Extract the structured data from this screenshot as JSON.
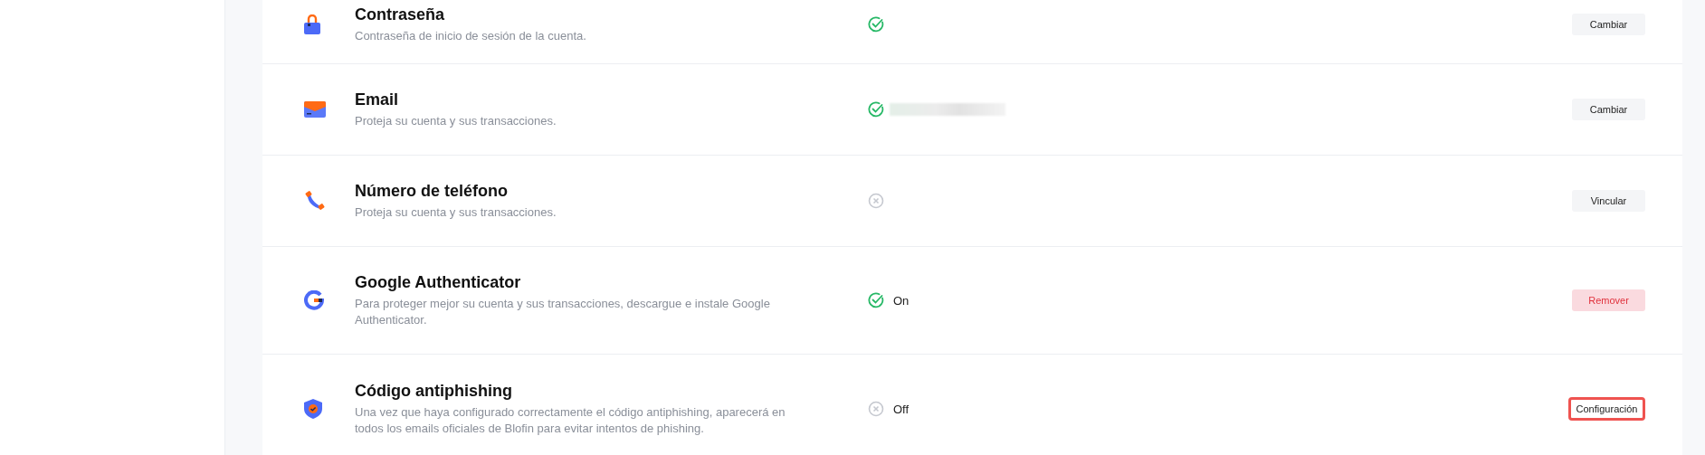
{
  "security_items": [
    {
      "title": "Contraseña",
      "description": "Contraseña de inicio de sesión de la cuenta.",
      "verified": true,
      "button": {
        "label": "Cambiar",
        "kind": "default",
        "highlighted": false
      }
    },
    {
      "title": "Email",
      "description": "Proteja su cuenta y sus transacciones.",
      "verified": true,
      "value_hidden": true,
      "button": {
        "label": "Cambiar",
        "kind": "default",
        "highlighted": false
      }
    },
    {
      "title": "Número de teléfono",
      "description": "Proteja su cuenta y sus transacciones.",
      "verified": false,
      "button": {
        "label": "Vincular",
        "kind": "default",
        "highlighted": false
      }
    },
    {
      "title": "Google Authenticator",
      "description": "Para proteger mejor su cuenta y sus transacciones, descargue e instale Google Authenticator.",
      "verified": true,
      "status_text": "On",
      "button": {
        "label": "Remover",
        "kind": "danger",
        "highlighted": false
      }
    },
    {
      "title": "Código antiphishing",
      "description": "Una vez que haya configurado correctamente el código antiphishing, aparecerá en todos los emails oficiales de Blofin para evitar intentos de phishing.",
      "verified": false,
      "status_text": "Off",
      "button": {
        "label": "Configuración",
        "kind": "default",
        "highlighted": true
      }
    }
  ]
}
